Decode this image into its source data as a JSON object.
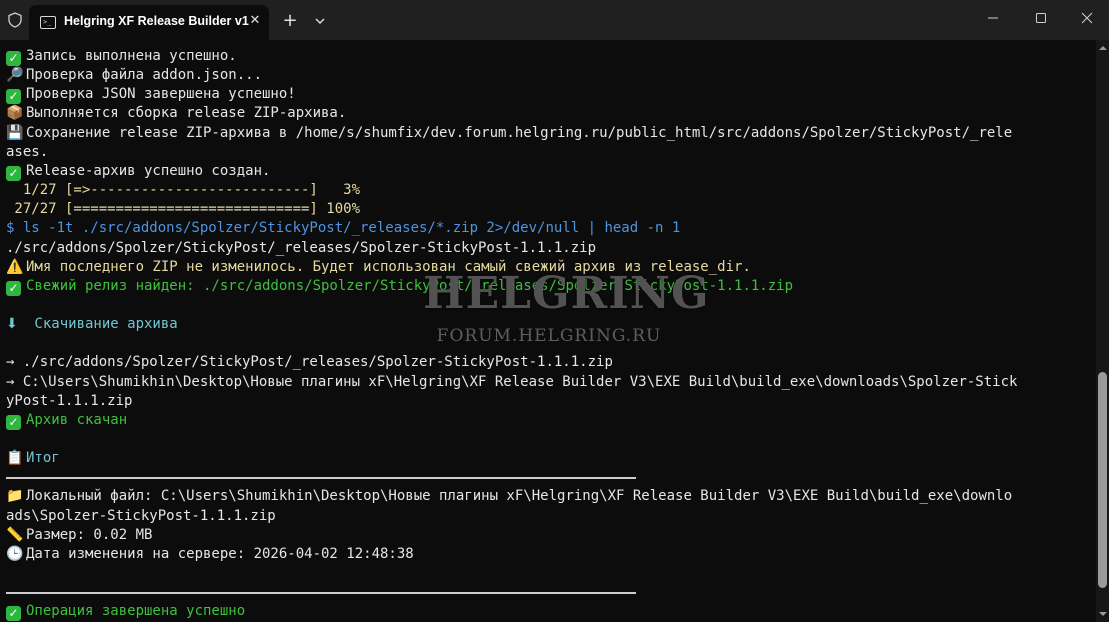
{
  "window": {
    "tab_title": "Helgring XF Release Builder v1",
    "tab_icon_text": ">_",
    "colors": {
      "titlebar": "#202020",
      "terminal_bg": "#0c0c0c",
      "green": "#3ec13f",
      "blue": "#4f95e0",
      "cyan": "#72c6d4",
      "yellow": "#e5d9a0"
    }
  },
  "terminal": {
    "lines": [
      {
        "icon": "check",
        "text": "Запись выполнена успешно.",
        "color": "white"
      },
      {
        "icon": "🔎",
        "text": "Проверка файла addon.json...",
        "color": "white"
      },
      {
        "icon": "check",
        "text": "Проверка JSON завершена успешно!",
        "color": "white"
      },
      {
        "icon": "📦",
        "text": "Выполняется сборка release ZIP-архива.",
        "color": "white"
      },
      {
        "icon": "💾",
        "text": "Сохранение release ZIP-архива в /home/s/shumfix/dev.forum.helgring.ru/public_html/src/addons/Spolzer/StickyPost/_rele",
        "color": "white"
      },
      {
        "icon": "",
        "text": "ases.",
        "color": "white"
      },
      {
        "icon": "check",
        "text": "Release-архив успешно создан.",
        "color": "white"
      },
      {
        "icon": "",
        "text": "  1/27 [=>--------------------------]   3%",
        "color": "yellow"
      },
      {
        "icon": "",
        "text": " 27/27 [============================] 100%",
        "color": "yellow"
      },
      {
        "icon": "",
        "text": "$ ls -1t ./src/addons/Spolzer/StickyPost/_releases/*.zip 2>/dev/null | head -n 1",
        "color": "blue"
      },
      {
        "icon": "",
        "text": "./src/addons/Spolzer/StickyPost/_releases/Spolzer-StickyPost-1.1.1.zip",
        "color": "white"
      },
      {
        "icon": "⚠️",
        "text": "Имя последнего ZIP не изменилось. Будет использован самый свежий архив из release_dir.",
        "color": "yellow"
      },
      {
        "icon": "check",
        "text": "Свежий релиз найден: ./src/addons/Spolzer/StickyPost/_releases/Spolzer-StickyPost-1.1.1.zip",
        "color": "green"
      },
      {
        "icon": "",
        "text": "",
        "color": "white"
      },
      {
        "icon": "⬇",
        "text": " Скачивание архива",
        "color": "cyan"
      },
      {
        "icon": "",
        "text": "",
        "color": "white"
      },
      {
        "icon": "",
        "text": "→ ./src/addons/Spolzer/StickyPost/_releases/Spolzer-StickyPost-1.1.1.zip",
        "color": "white"
      },
      {
        "icon": "",
        "text": "→ C:\\Users\\Shumikhin\\Desktop\\Новые плагины xF\\Helgring\\XF Release Builder V3\\EXE Build\\build_exe\\downloads\\Spolzer-Stick",
        "color": "white"
      },
      {
        "icon": "",
        "text": "yPost-1.1.1.zip",
        "color": "white"
      },
      {
        "icon": "check",
        "text": "Архив скачан",
        "color": "green"
      },
      {
        "icon": "",
        "text": "",
        "color": "white"
      },
      {
        "icon": "📋",
        "text": "Итог",
        "color": "cyan"
      },
      {
        "icon": "rule",
        "text": "",
        "color": "white"
      },
      {
        "icon": "📁",
        "text": "Локальный файл: C:\\Users\\Shumikhin\\Desktop\\Новые плагины xF\\Helgring\\XF Release Builder V3\\EXE Build\\build_exe\\downlo",
        "color": "white"
      },
      {
        "icon": "",
        "text": "ads\\Spolzer-StickyPost-1.1.1.zip",
        "color": "white"
      },
      {
        "icon": "📏",
        "text": "Размер: 0.02 MB",
        "color": "white"
      },
      {
        "icon": "🕒",
        "text": "Дата изменения на сервере: 2026-04-02 12:48:38",
        "color": "white"
      },
      {
        "icon": "",
        "text": "",
        "color": "white"
      },
      {
        "icon": "rule",
        "text": "",
        "color": "white"
      },
      {
        "icon": "check",
        "text": "Операция завершена успешно",
        "color": "green"
      }
    ]
  },
  "watermark": {
    "title": "HELGRING",
    "subtitle": "FORUM.HELGRING.RU"
  }
}
